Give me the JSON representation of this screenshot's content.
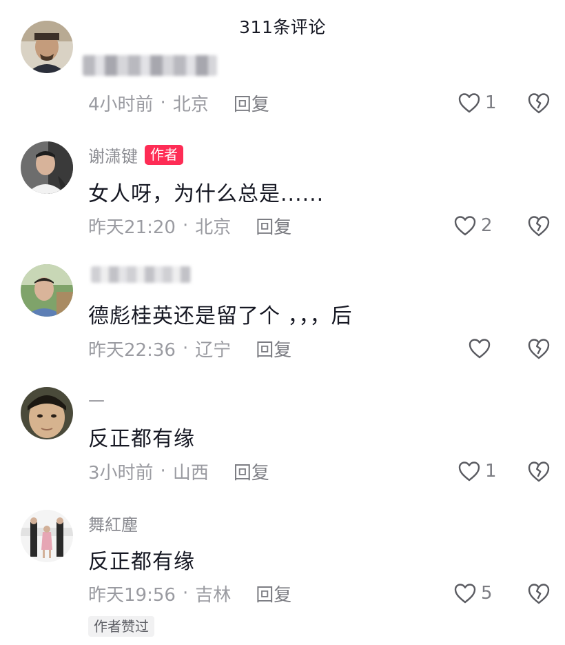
{
  "header": {
    "title": "311条评论"
  },
  "comments": [
    {
      "username": "",
      "text": "",
      "time": "4小时前",
      "location": "北京",
      "reply_label": "回复",
      "likes": "1"
    },
    {
      "username": "谢潇键",
      "author_tag": "作者",
      "text": "女人呀，为什么总是......",
      "time": "昨天21:20",
      "location": "北京",
      "reply_label": "回复",
      "likes": "2"
    },
    {
      "username": "",
      "text": "德彪桂英还是留了个 ，，，后",
      "time": "昨天22:36",
      "location": "辽宁",
      "reply_label": "回复",
      "likes": ""
    },
    {
      "username": "—",
      "text": "反正都有缘",
      "time": "3小时前",
      "location": "山西",
      "reply_label": "回复",
      "likes": "1"
    },
    {
      "username": "舞紅塵",
      "text": "反正都有缘",
      "time": "昨天19:56",
      "location": "吉林",
      "reply_label": "回复",
      "likes": "5",
      "badge": "作者赞过"
    }
  ],
  "colors": {
    "accent": "#fe2c55",
    "text_primary": "#161823",
    "text_secondary": "#8a8b91"
  },
  "icons": {
    "like": "heart-outline-icon",
    "dislike": "broken-heart-icon"
  }
}
